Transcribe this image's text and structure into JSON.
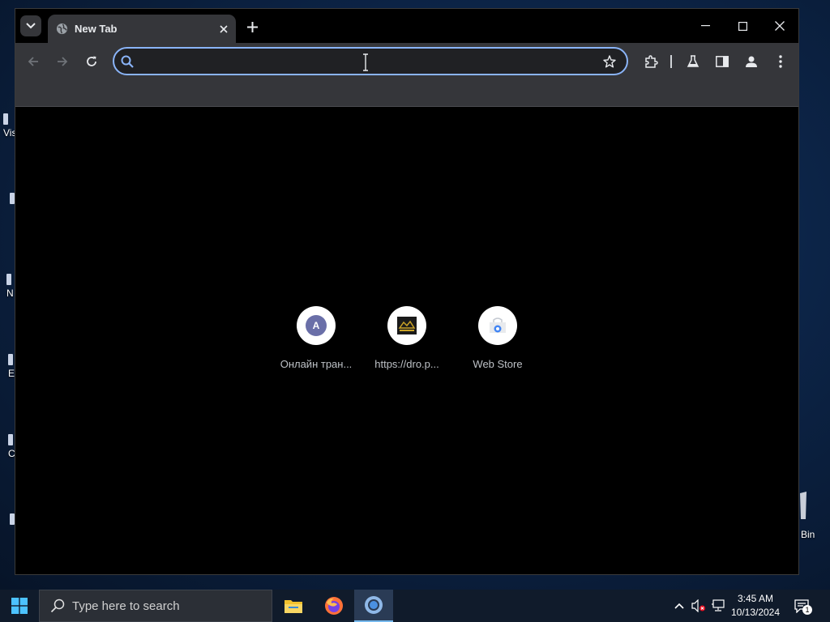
{
  "browser": {
    "tab": {
      "title": "New Tab"
    },
    "omnibox": {
      "value": "",
      "placeholder": ""
    },
    "shortcuts": [
      {
        "label": "Онлайн тран...",
        "icon_letter": "A"
      },
      {
        "label": "https://dro.p..."
      },
      {
        "label": "Web Store"
      }
    ]
  },
  "desktop": {
    "icons": [
      {
        "label": "Vis"
      },
      {
        "label": ""
      },
      {
        "label": "N"
      },
      {
        "label": "E"
      },
      {
        "label": "C"
      },
      {
        "label": ""
      },
      {
        "label": "Bin"
      }
    ]
  },
  "taskbar": {
    "search_placeholder": "Type here to search",
    "clock_time": "3:45 AM",
    "clock_date": "10/13/2024",
    "notification_count": "1"
  },
  "colors": {
    "accent": "#8ab4f8",
    "toolbar": "#35363a",
    "content_bg": "#000000"
  }
}
